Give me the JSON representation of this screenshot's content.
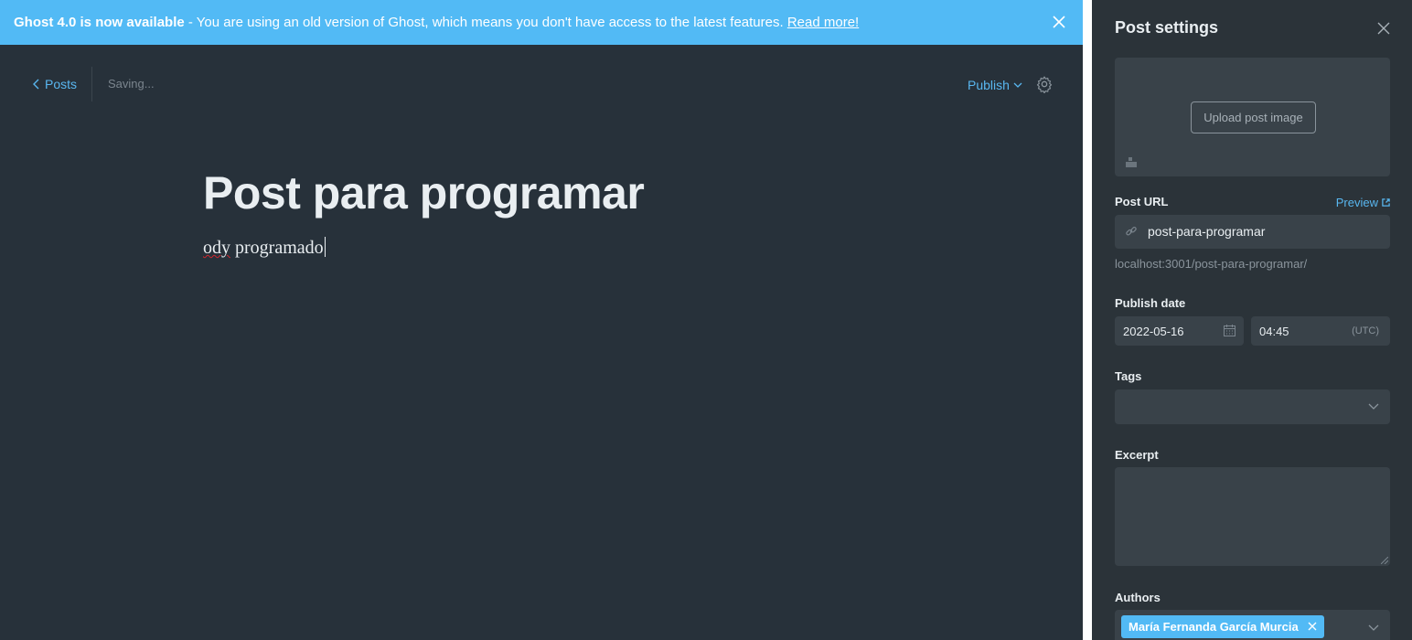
{
  "banner": {
    "headline": "Ghost 4.0 is now available",
    "message": " - You are using an old version of Ghost, which means you don't have access to the latest features. ",
    "link": "Read more!",
    "color": "#52baf5"
  },
  "toolbar": {
    "back_label": "Posts",
    "status": "Saving...",
    "publish_label": "Publish"
  },
  "editor": {
    "title": "Post para programar",
    "body_misspelled": "ody",
    "body_rest": " programado"
  },
  "settings": {
    "title": "Post settings",
    "upload_label": "Upload post image",
    "post_url_label": "Post URL",
    "preview_label": "Preview",
    "slug": "post-para-programar",
    "full_url": "localhost:3001/post-para-programar/",
    "publish_date_label": "Publish date",
    "date": "2022-05-16",
    "time": "04:45",
    "timezone": "(UTC)",
    "tags_label": "Tags",
    "excerpt_label": "Excerpt",
    "authors_label": "Authors",
    "authors": [
      "María Fernanda García Murcia"
    ]
  },
  "colors": {
    "accent": "#52baf5",
    "editor_bg": "#27313a",
    "panel_bg": "#2b3339",
    "field_bg": "#394249"
  }
}
